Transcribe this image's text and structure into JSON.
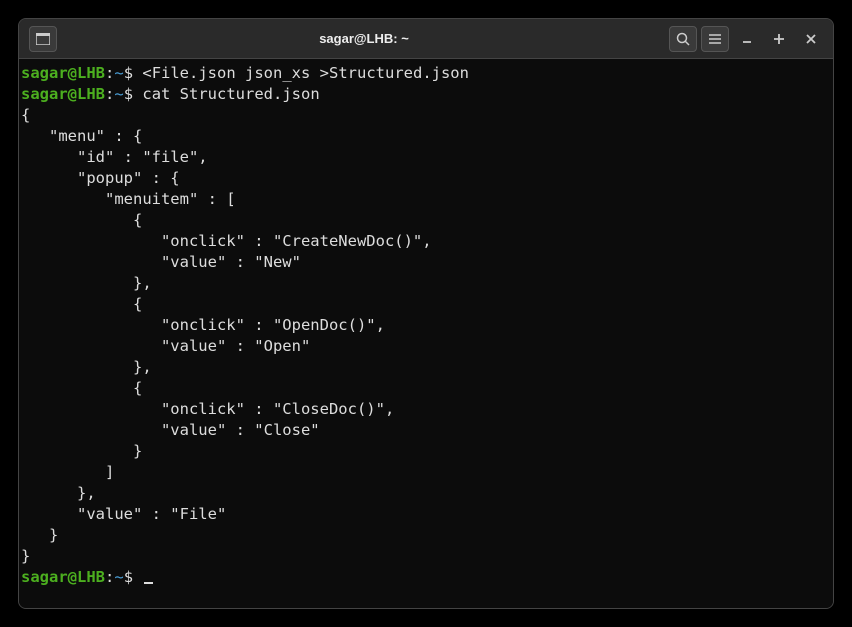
{
  "titlebar": {
    "title": "sagar@LHB: ~"
  },
  "prompt": {
    "user": "sagar@LHB",
    "colon": ":",
    "path": "~",
    "dollar": "$ "
  },
  "commands": {
    "cmd1": "<File.json json_xs >Structured.json",
    "cmd2": "cat Structured.json"
  },
  "output": {
    "l1": "{",
    "l2": "   \"menu\" : {",
    "l3": "      \"id\" : \"file\",",
    "l4": "      \"popup\" : {",
    "l5": "         \"menuitem\" : [",
    "l6": "            {",
    "l7": "               \"onclick\" : \"CreateNewDoc()\",",
    "l8": "               \"value\" : \"New\"",
    "l9": "            },",
    "l10": "            {",
    "l11": "               \"onclick\" : \"OpenDoc()\",",
    "l12": "               \"value\" : \"Open\"",
    "l13": "            },",
    "l14": "            {",
    "l15": "               \"onclick\" : \"CloseDoc()\",",
    "l16": "               \"value\" : \"Close\"",
    "l17": "            }",
    "l18": "         ]",
    "l19": "      },",
    "l20": "      \"value\" : \"File\"",
    "l21": "   }",
    "l22": "}"
  }
}
